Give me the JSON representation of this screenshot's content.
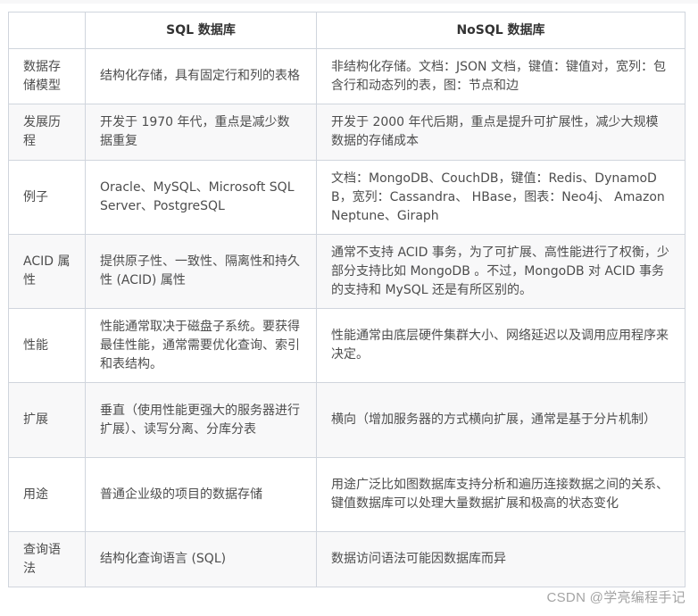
{
  "table": {
    "headers": [
      "",
      "SQL 数据库",
      "NoSQL 数据库"
    ],
    "rows": [
      {
        "label": "数据存储模型",
        "sql": "结构化存储，具有固定行和列的表格",
        "nosql": "非结构化存储。文档：JSON 文档，键值：键值对，宽列：包含行和动态列的表，图：节点和边"
      },
      {
        "label": "发展历程",
        "sql": "开发于 1970 年代，重点是减少数据重复",
        "nosql": "开发于 2000 年代后期，重点是提升可扩展性，减少大规模数据的存储成本"
      },
      {
        "label": "例子",
        "sql": "Oracle、MySQL、Microsoft SQL Server、PostgreSQL",
        "nosql": "文档：MongoDB、CouchDB，键值：Redis、DynamoDB，宽列：Cassandra、 HBase，图表：Neo4j、 Amazon Neptune、Giraph"
      },
      {
        "label": "ACID 属性",
        "sql": "提供原子性、一致性、隔离性和持久性 (ACID) 属性",
        "nosql": "通常不支持 ACID 事务，为了可扩展、高性能进行了权衡，少部分支持比如 MongoDB 。不过，MongoDB 对 ACID 事务 的支持和 MySQL 还是有所区别的。"
      },
      {
        "label": "性能",
        "sql": "性能通常取决于磁盘子系统。要获得最佳性能，通常需要优化查询、索引和表结构。",
        "nosql": "性能通常由底层硬件集群大小、网络延迟以及调用应用程序来决定。"
      },
      {
        "label": "扩展",
        "sql": "垂直（使用性能更强大的服务器进行扩展）、读写分离、分库分表",
        "nosql": "横向（增加服务器的方式横向扩展，通常是基于分片机制）"
      },
      {
        "label": "用途",
        "sql": "普通企业级的项目的数据存储",
        "nosql": "用途广泛比如图数据库支持分析和遍历连接数据之间的关系、键值数据库可以处理大量数据扩展和极高的状态变化"
      },
      {
        "label": "查询语法",
        "sql": "结构化查询语言 (SQL)",
        "nosql": "数据访问语法可能因数据库而异"
      }
    ]
  },
  "watermark": "CSDN @学亮编程手记",
  "colors": {
    "border": "#d0d5dd",
    "alt_row_bg": "#f8f8f9",
    "text": "#4d4d4d",
    "header_text": "#333333"
  }
}
